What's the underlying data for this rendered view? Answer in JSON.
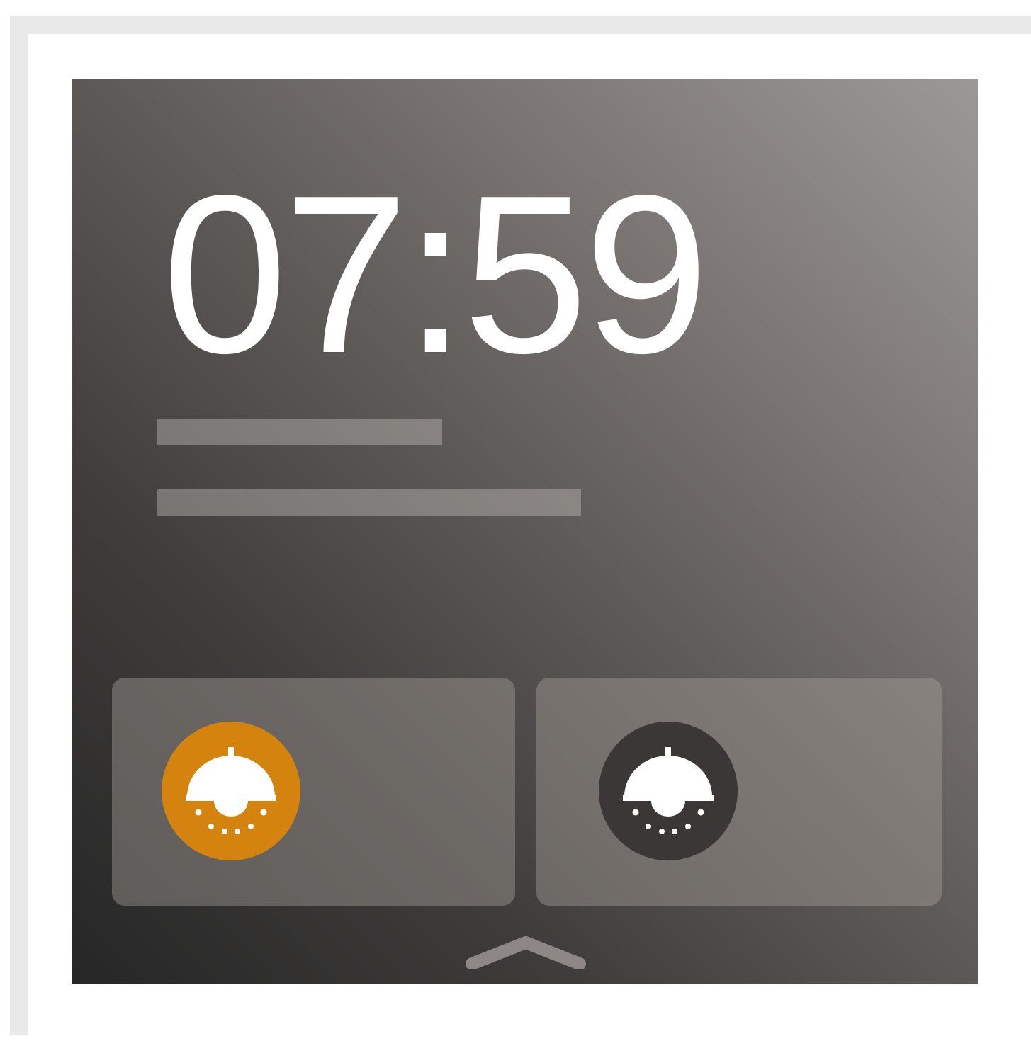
{
  "clock": {
    "time": "07:59"
  },
  "tiles": [
    {
      "icon": "ceiling-lamp-icon",
      "state": "on",
      "color": "#d4830f"
    },
    {
      "icon": "ceiling-lamp-icon",
      "state": "off",
      "color": "#3b3736"
    }
  ],
  "navigation": {
    "icon": "chevron-up-icon"
  },
  "colors": {
    "text": "#ffffff",
    "accent_on": "#d4830f",
    "button_off": "#3b3736"
  }
}
